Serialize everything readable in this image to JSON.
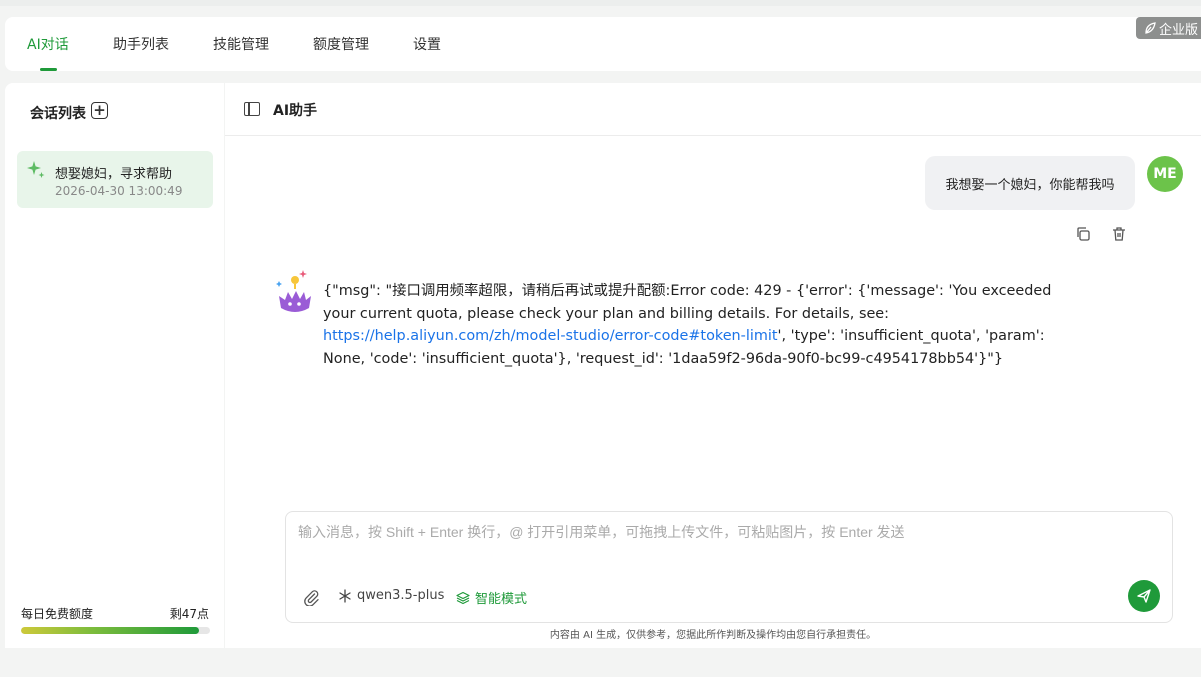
{
  "nav": {
    "tabs": [
      {
        "label": "AI对话",
        "active": true
      },
      {
        "label": "助手列表",
        "active": false
      },
      {
        "label": "技能管理",
        "active": false
      },
      {
        "label": "额度管理",
        "active": false
      },
      {
        "label": "设置",
        "active": false
      }
    ],
    "enterprise_badge": "企业版",
    "accent_color": "#1f9a3a"
  },
  "sidebar": {
    "title": "会话列表",
    "add_icon": "plus-square-icon",
    "conversations": [
      {
        "title": "想娶媳妇，寻求帮助",
        "time": "2026-04-30 13:00:49",
        "icon": "sparkle-icon",
        "selected": true
      }
    ],
    "quota": {
      "label": "每日免费额度",
      "remaining": "剩47点",
      "fraction": 0.94
    }
  },
  "main": {
    "title": "AI助手",
    "messages": [
      {
        "role": "user",
        "avatar": "ME",
        "text": "我想娶一个媳妇，你能帮我吗",
        "actions": [
          "copy-icon",
          "trash-icon"
        ]
      },
      {
        "role": "assistant",
        "text_before_link": "{\"msg\": \"接口调用频率超限，请稍后再试或提升配额:Error code: 429 - {'error': {'message': 'You exceeded your current quota, please check your plan and billing details. For details, see: ",
        "link": "https://help.aliyun.com/zh/model-studio/error-code#token-limit",
        "text_after_link": "', 'type': 'insufficient_quota', 'param': None, 'code': 'insufficient_quota'}, 'request_id': '1daa59f2-96da-90f0-bc99-c4954178bb54'}\"}"
      }
    ],
    "composer": {
      "placeholder": "输入消息，按 Shift + Enter 换行，@ 打开引用菜单，可拖拽上传文件，可粘贴图片，按 Enter 发送",
      "model": "qwen3.5-plus",
      "mode": "智能模式"
    },
    "disclaimer": "内容由 AI 生成，仅供参考，您据此所作判断及操作均由您自行承担责任。"
  }
}
